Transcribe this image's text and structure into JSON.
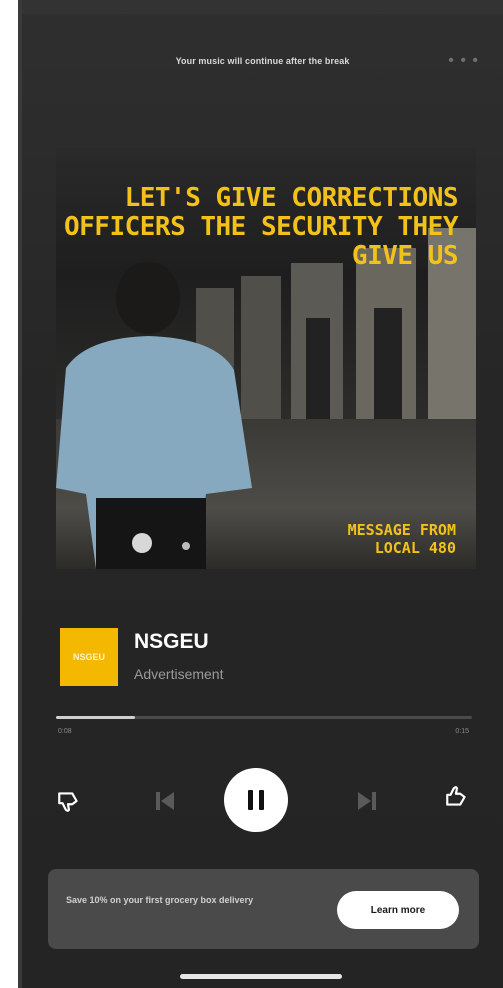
{
  "top_bar": {
    "message": "Your music will continue after the break",
    "more_icon": "more-dots-icon"
  },
  "artwork": {
    "headline": "LET'S GIVE CORRECTIONS OFFICERS THE SECURITY THEY GIVE US",
    "sponsor_note_line1": "MESSAGE FROM",
    "sponsor_note_line2": "LOCAL 480",
    "accent_color": "#f3c21a"
  },
  "track": {
    "logo_text": "NSGEU",
    "title": "NSGEU",
    "subtitle": "Advertisement"
  },
  "progress": {
    "elapsed": "0:08",
    "duration": "0:15",
    "fraction": 0.19
  },
  "controls": {
    "dislike_icon": "thumbs-down-icon",
    "previous_icon": "skip-previous-icon",
    "play_pause_icon": "pause-icon",
    "next_icon": "skip-next-icon",
    "like_icon": "thumbs-up-icon"
  },
  "promo": {
    "text": "Save 10% on your first grocery box delivery",
    "button_label": "Learn more"
  }
}
